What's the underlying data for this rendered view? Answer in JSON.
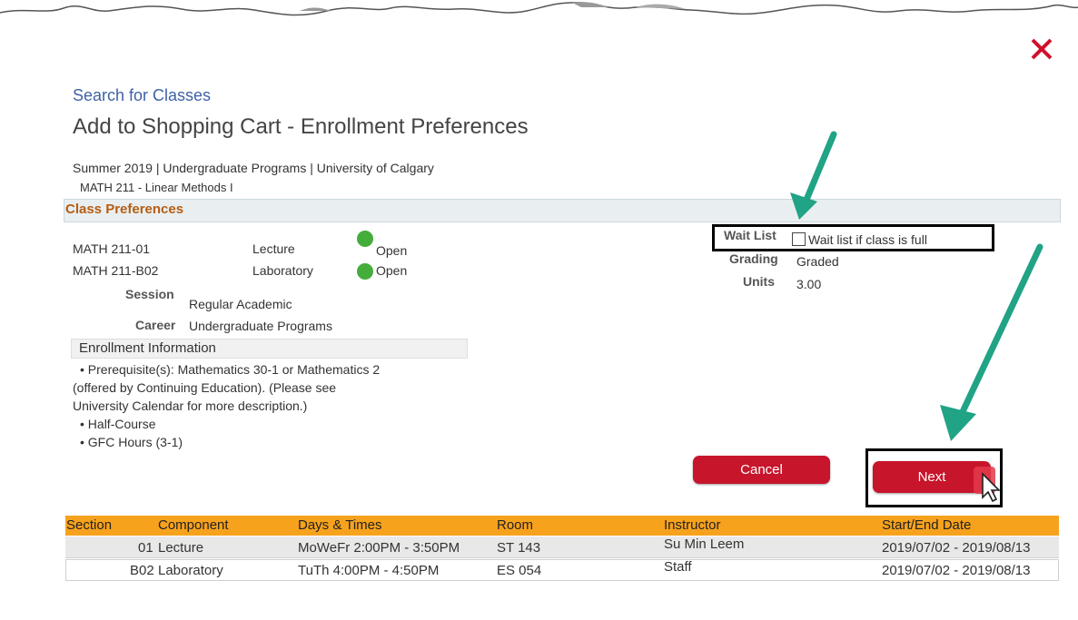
{
  "colors": {
    "accent_red": "#c7152b",
    "link_blue": "#3f62a5",
    "section_orange": "#b55d12",
    "table_header": "#f7a21d",
    "open_green": "#44ad3c",
    "arrow_teal": "#21a385"
  },
  "header": {
    "breadcrumb": "Search for Classes",
    "title": "Add to Shopping Cart - Enrollment Preferences",
    "term_line": "Summer 2019 | Undergraduate Programs | University of Calgary",
    "course_line": "MATH  211 - Linear Methods I",
    "close_icon": "close-x-icon"
  },
  "class_preferences": {
    "title": "Class Preferences",
    "sections": [
      {
        "id": "MATH  211-01",
        "type": "Lecture",
        "status": "Open"
      },
      {
        "id": "MATH  211-B02",
        "type": "Laboratory",
        "status": "Open"
      }
    ],
    "session_label": "Session",
    "session_value": "Regular Academic",
    "career_label": "Career",
    "career_value": "Undergraduate Programs",
    "wait_list_label": "Wait List",
    "wait_list_option": "Wait list if class is full",
    "grading_label": "Grading",
    "grading_value": "Graded",
    "units_label": "Units",
    "units_value": "3.00"
  },
  "enrollment_information": {
    "title": "Enrollment Information",
    "lines": [
      "•  Prerequisite(s): Mathematics 30-1 or Mathematics 2",
      "(offered by Continuing Education). (Please see",
      "University Calendar for more description.)",
      "•  Half-Course",
      "•  GFC Hours (3-1)"
    ]
  },
  "buttons": {
    "cancel": "Cancel",
    "next": "Next"
  },
  "table": {
    "columns": [
      "Section",
      "Component",
      "Days & Times",
      "Room",
      "Instructor",
      "Start/End Date"
    ],
    "rows": [
      {
        "section": "01",
        "component": "Lecture",
        "days_times": "MoWeFr 2:00PM - 3:50PM",
        "room": "ST 143",
        "instructor": "Su Min Leem",
        "dates": "2019/07/02 - 2019/08/13"
      },
      {
        "section": "B02",
        "component": "Laboratory",
        "days_times": "TuTh 4:00PM - 4:50PM",
        "room": "ES 054",
        "instructor": "Staff",
        "dates": "2019/07/02 - 2019/08/13"
      }
    ]
  }
}
